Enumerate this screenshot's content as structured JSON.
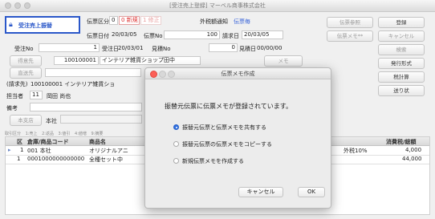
{
  "window": {
    "title": "[受注売上登録] マーベル商事株式会社"
  },
  "badge": {
    "label": "受注売上振替"
  },
  "header": {
    "denpyo_kubun_label": "伝票区分",
    "denpyo_kubun_value": "0",
    "denpyo_kubun_sel": "0 新規",
    "denpyo_kubun_alt": "1 修正",
    "gaika_label": "外税額通知",
    "gaika_value": "伝票毎",
    "denpyo_date_label": "伝票日付",
    "denpyo_date": "20/03/05",
    "denpyo_no_label": "伝票No",
    "denpyo_no": "100",
    "seikyu_date_label": "請求日",
    "seikyu_date": "20/03/05",
    "juchu_no_label": "受注No",
    "juchu_no": "1",
    "juchu_date_label": "受注日",
    "juchu_date": "20/03/01",
    "mitsumori_no_label": "見積No",
    "mitsumori_no": "0",
    "mitsumori_date_label": "見積日",
    "mitsumori_date": "00/00/00",
    "tokui_label": "得意先",
    "tokui_code": "100100001",
    "tokui_name": "インテリア雑貨ショップ田中",
    "memo_label": "メモ",
    "chokuso_label": "直送先",
    "seikyu_label": "(請求先)",
    "seikyu_value": "100100001 インテリア雑貨ショ",
    "tanto_label": "担当者",
    "tanto_code": "11",
    "tanto_name": "岡田 尚也",
    "biko_label": "備考",
    "shiten_label": "本支店",
    "shiten_value": "本社"
  },
  "right_buttons": [
    "伝票参照",
    "登録",
    "伝票メモ**",
    "キャンセル",
    "検索",
    "発行形式",
    "税計算",
    "送り状"
  ],
  "tabs": [
    "取引区分",
    "1:売上",
    "2:返品",
    "3:値引",
    "4:値増",
    "9:摘要"
  ],
  "grid": {
    "headers": [
      "区",
      "倉庫/商品コード",
      "商品名",
      "消費税/総額"
    ],
    "rows": [
      {
        "ku": "1",
        "code": "001 本社",
        "name": "オリジナルアニ",
        "tax": "外税10%",
        "amount": "4,000"
      },
      {
        "ku": "1",
        "code": "0001000000000000",
        "name": "全種セット中",
        "tax": "",
        "amount": "44,000"
      }
    ]
  },
  "dialog": {
    "title": "伝票メモ作成",
    "message": "振替元伝票に伝票メモが登録されています。",
    "options": [
      "振替元伝票と伝票メモを共有する",
      "振替元伝票の伝票メモをコピーする",
      "新規伝票メモを作成する"
    ],
    "selected": 0,
    "cancel": "キャンセル",
    "ok": "OK"
  }
}
